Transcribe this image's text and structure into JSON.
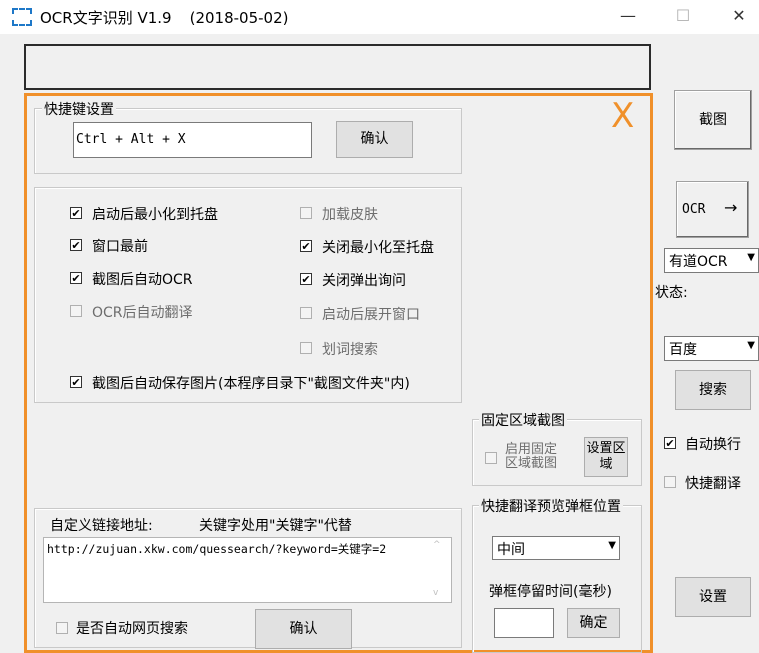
{
  "window": {
    "title": "OCR文字识别 V1.9",
    "date": "(2018-05-02)",
    "minimize": "—",
    "maximize": "☐",
    "close": "✕"
  },
  "overlay_mark": "X",
  "hotkey": {
    "legend": "快捷键设置",
    "value": "Ctrl + Alt + X",
    "confirm": "确认"
  },
  "options": {
    "left": [
      {
        "label": "启动后最小化到托盘",
        "checked": true
      },
      {
        "label": "窗口最前",
        "checked": true
      },
      {
        "label": "截图后自动OCR",
        "checked": true
      },
      {
        "label": "OCR后自动翻译",
        "checked": false
      }
    ],
    "right": [
      {
        "label": "加载皮肤",
        "checked": false
      },
      {
        "label": "关闭最小化至托盘",
        "checked": true
      },
      {
        "label": "关闭弹出询问",
        "checked": true
      },
      {
        "label": "启动后展开窗口",
        "checked": false
      },
      {
        "label": "划词搜索",
        "checked": false
      }
    ],
    "save": {
      "label": "截图后自动保存图片(本程序目录下\"截图文件夹\"内)",
      "checked": true
    }
  },
  "fixed_area": {
    "legend": "固定区域截图",
    "enable_label": "启用固定区域截图",
    "set_button": "设置区域"
  },
  "custom_link": {
    "label": "自定义链接地址:",
    "hint": "关键字处用\"关键字\"代替",
    "value": "http://zujuan.xkw.com/quessearch/?keyword=关键字=2",
    "auto_search_label": "是否自动网页搜索",
    "confirm": "确认"
  },
  "popup": {
    "legend": "快捷翻译预览弹框位置",
    "position": "中间",
    "stay_label": "弹框停留时间(毫秒)",
    "confirm": "确定"
  },
  "side": {
    "screenshot": "截图",
    "ocr": "OCR",
    "ocr_arrow": "→",
    "engine": "有道OCR",
    "status_label": "状态:",
    "search_engine": "百度",
    "search": "搜索",
    "auto_wrap": "自动换行",
    "quick_translate": "快捷翻译",
    "settings": "设置"
  },
  "colors": {
    "accent": "#f0902a",
    "checked": "#000000"
  }
}
